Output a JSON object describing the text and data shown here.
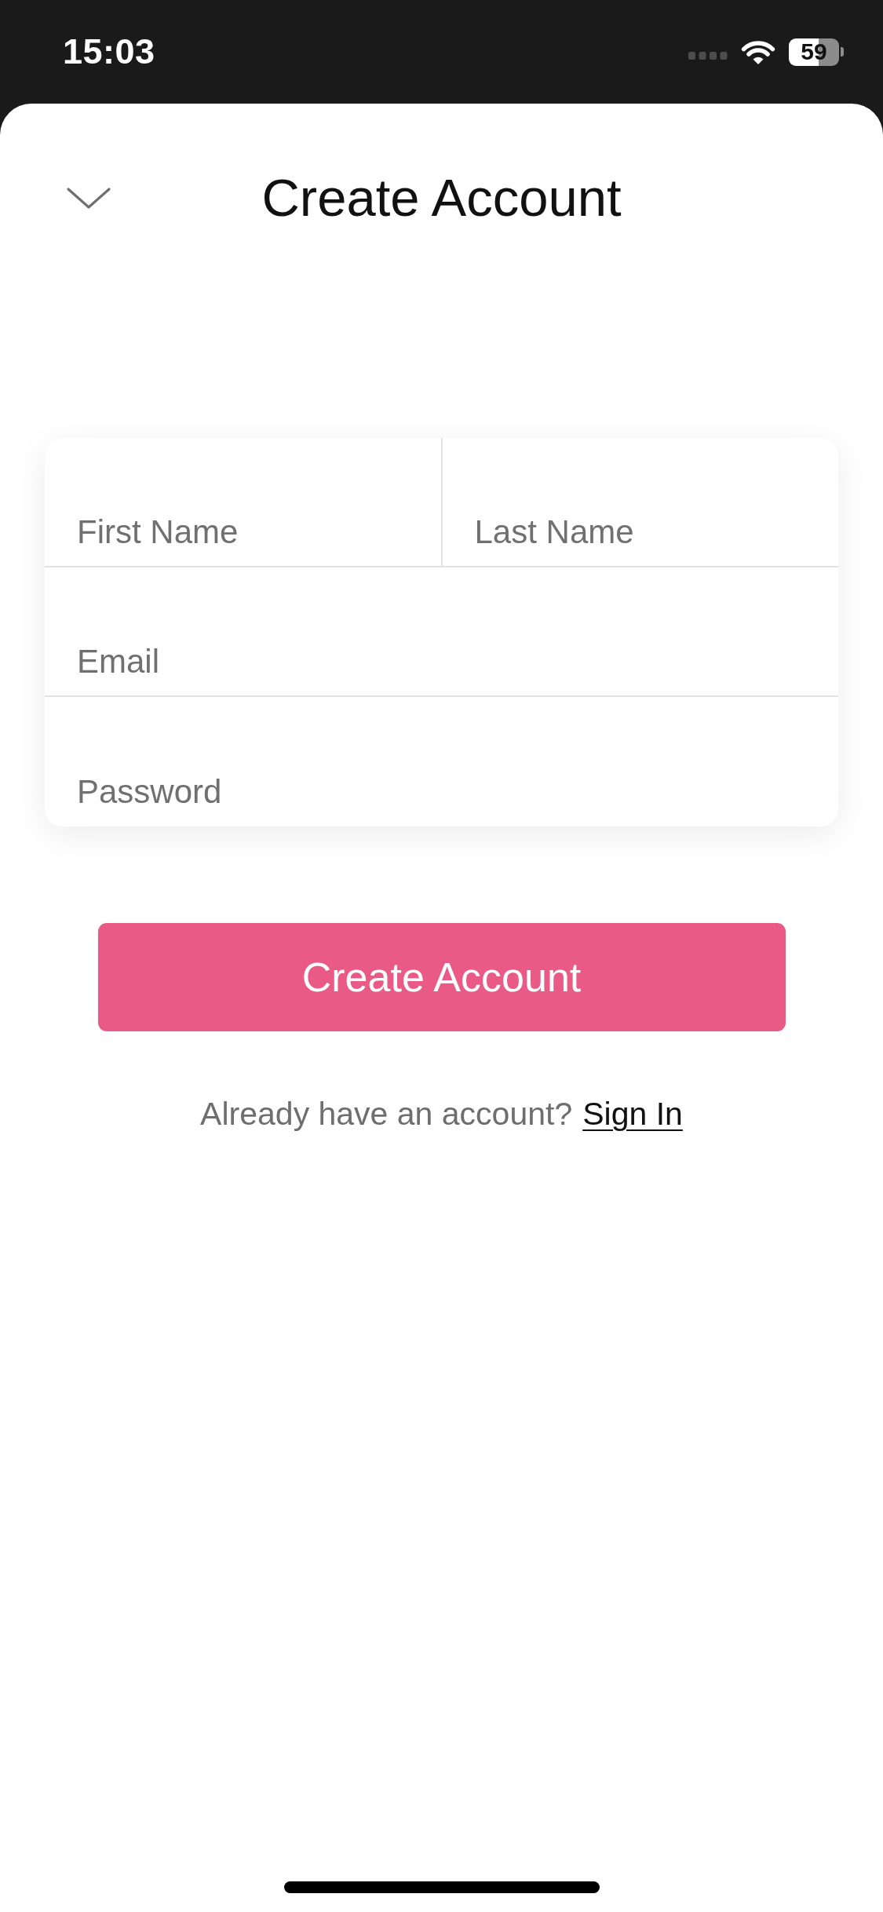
{
  "status_bar": {
    "time": "15:03",
    "battery": "59"
  },
  "header": {
    "title": "Create Account"
  },
  "form": {
    "rows": [
      {
        "fields": [
          {
            "placeholder": "First Name"
          },
          {
            "placeholder": "Last Name"
          }
        ]
      },
      {
        "fields": [
          {
            "placeholder": "Email"
          }
        ]
      },
      {
        "fields": [
          {
            "placeholder": "Password"
          }
        ]
      }
    ]
  },
  "submit_button": {
    "label": "Create Account"
  },
  "sign_in_prompt": {
    "text": "Already have an account?",
    "link": "Sign In"
  }
}
